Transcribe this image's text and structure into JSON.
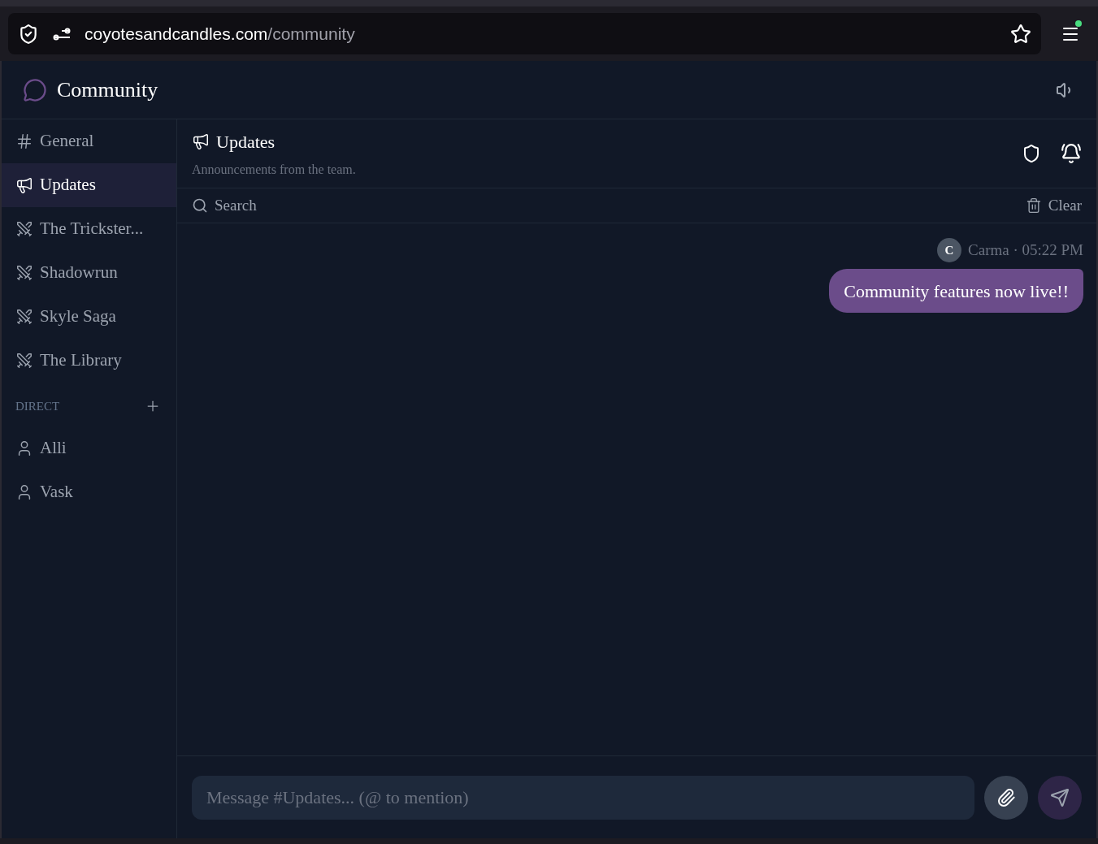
{
  "browser": {
    "url_host": "coyotesandcandles.com",
    "url_path": "/community",
    "menu_badge": true
  },
  "app": {
    "title": "Community"
  },
  "sidebar": {
    "channels": [
      {
        "label": "General",
        "kind": "text",
        "selected": false
      },
      {
        "label": "Updates",
        "kind": "announcement",
        "selected": true
      },
      {
        "label": "The Trickster...",
        "kind": "game",
        "selected": false
      },
      {
        "label": "Shadowrun",
        "kind": "game",
        "selected": false
      },
      {
        "label": "Skyle Saga",
        "kind": "game",
        "selected": false
      },
      {
        "label": "The Library",
        "kind": "game",
        "selected": false
      }
    ],
    "direct_heading": "DIRECT",
    "direct": [
      {
        "label": "Alli",
        "selected": false
      },
      {
        "label": "Vask",
        "selected": false
      }
    ]
  },
  "channel": {
    "title": "Updates",
    "description": "Announcements from the team.",
    "search": {
      "placeholder": "Search"
    },
    "clear": "Clear"
  },
  "messages": [
    {
      "avatar": "C",
      "meta": "Carma · 05:22 PM",
      "text": "Community features now live!!"
    }
  ],
  "composer": {
    "placeholder": "Message #Updates... (@ to mention)"
  }
}
